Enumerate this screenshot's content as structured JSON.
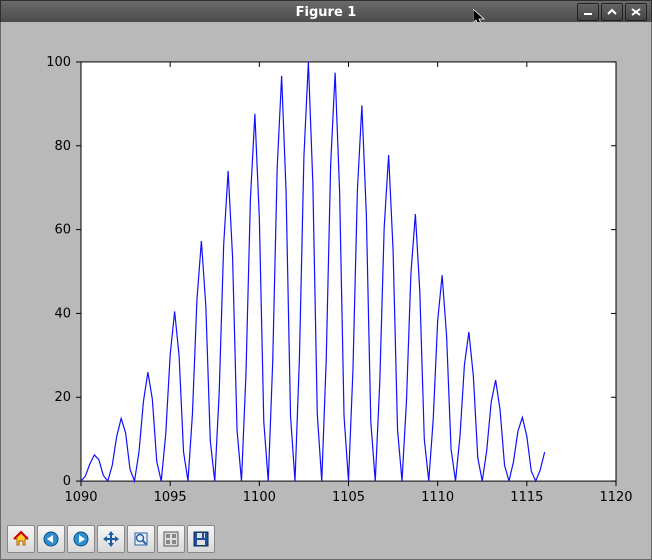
{
  "window": {
    "title": "Figure 1",
    "buttons": {
      "min": "_",
      "max": "^",
      "close": "×"
    }
  },
  "chart_data": {
    "type": "line",
    "title": "",
    "xlabel": "",
    "ylabel": "",
    "xlim": [
      1090,
      1120
    ],
    "ylim": [
      0,
      100
    ],
    "xticks": [
      1090,
      1095,
      1100,
      1105,
      1110,
      1115,
      1120
    ],
    "yticks": [
      0,
      20,
      40,
      60,
      80,
      100
    ],
    "series": [
      {
        "name": "",
        "color": "#1414ff",
        "x": [
          1090.0,
          1090.25,
          1090.5,
          1090.75,
          1091.0,
          1091.25,
          1091.5,
          1091.75,
          1092.0,
          1092.25,
          1092.5,
          1092.75,
          1093.0,
          1093.25,
          1093.5,
          1093.75,
          1094.0,
          1094.25,
          1094.5,
          1094.75,
          1095.0,
          1095.25,
          1095.5,
          1095.75,
          1096.0,
          1096.25,
          1096.5,
          1096.75,
          1097.0,
          1097.25,
          1097.5,
          1097.75,
          1098.0,
          1098.25,
          1098.5,
          1098.75,
          1099.0,
          1099.25,
          1099.5,
          1099.75,
          1100.0,
          1100.25,
          1100.5,
          1100.75,
          1101.0,
          1101.25,
          1101.5,
          1101.75,
          1102.0,
          1102.25,
          1102.5,
          1102.75,
          1103.0,
          1103.25,
          1103.5,
          1103.75,
          1104.0,
          1104.25,
          1104.5,
          1104.75,
          1105.0,
          1105.25,
          1105.5,
          1105.75,
          1106.0,
          1106.25,
          1106.5,
          1106.75,
          1107.0,
          1107.25,
          1107.5,
          1107.75,
          1108.0,
          1108.25,
          1108.5,
          1108.75,
          1109.0,
          1109.25,
          1109.5,
          1109.75,
          1110.0,
          1110.25,
          1110.5,
          1110.75,
          1111.0,
          1111.25,
          1111.5,
          1111.75,
          1112.0,
          1112.25,
          1112.5,
          1112.75,
          1113.0,
          1113.25,
          1113.5,
          1113.75,
          1114.0,
          1114.25,
          1114.5,
          1114.75,
          1115.0,
          1115.25,
          1115.5,
          1115.75,
          1116.0
        ],
        "y": [
          0.0,
          0.27,
          0.9,
          1.36,
          1.12,
          0.3,
          0.0,
          0.81,
          2.31,
          3.26,
          2.51,
          0.61,
          0.0,
          1.5,
          4.13,
          5.66,
          4.26,
          1.01,
          0.0,
          2.42,
          6.56,
          8.82,
          6.52,
          1.52,
          0.0,
          3.51,
          9.41,
          12.48,
          9.1,
          2.09,
          0.0,
          4.62,
          12.28,
          16.12,
          11.64,
          2.64,
          0.0,
          5.56,
          14.67,
          19.09,
          13.68,
          3.08,
          0.0,
          6.19,
          16.26,
          21.06,
          15.03,
          3.37,
          0.0,
          6.44,
          16.87,
          21.79,
          15.51,
          3.47,
          0.0,
          6.29,
          16.46,
          21.23,
          15.09,
          3.37,
          0.0,
          5.8,
          15.15,
          19.53,
          13.87,
          3.09,
          0.0,
          5.04,
          13.16,
          16.95,
          12.01,
          2.67,
          0.0,
          4.14,
          10.79,
          13.88,
          9.82,
          2.18,
          0.0,
          3.2,
          8.33,
          10.7,
          7.56,
          1.67,
          0.0,
          2.32,
          6.04,
          7.75,
          5.47,
          1.21,
          0.0,
          1.58,
          4.1,
          5.25,
          3.7,
          0.82,
          0.0,
          1.0,
          2.59,
          3.31,
          2.33,
          0.51,
          0.0,
          0.58,
          1.51
        ],
        "_y_display_scale": 4.59
      }
    ]
  },
  "toolbar": {
    "home": "Home",
    "back": "Back",
    "forward": "Forward",
    "pan": "Pan",
    "zoom": "Zoom",
    "subplots": "Configure subplots",
    "save": "Save"
  }
}
